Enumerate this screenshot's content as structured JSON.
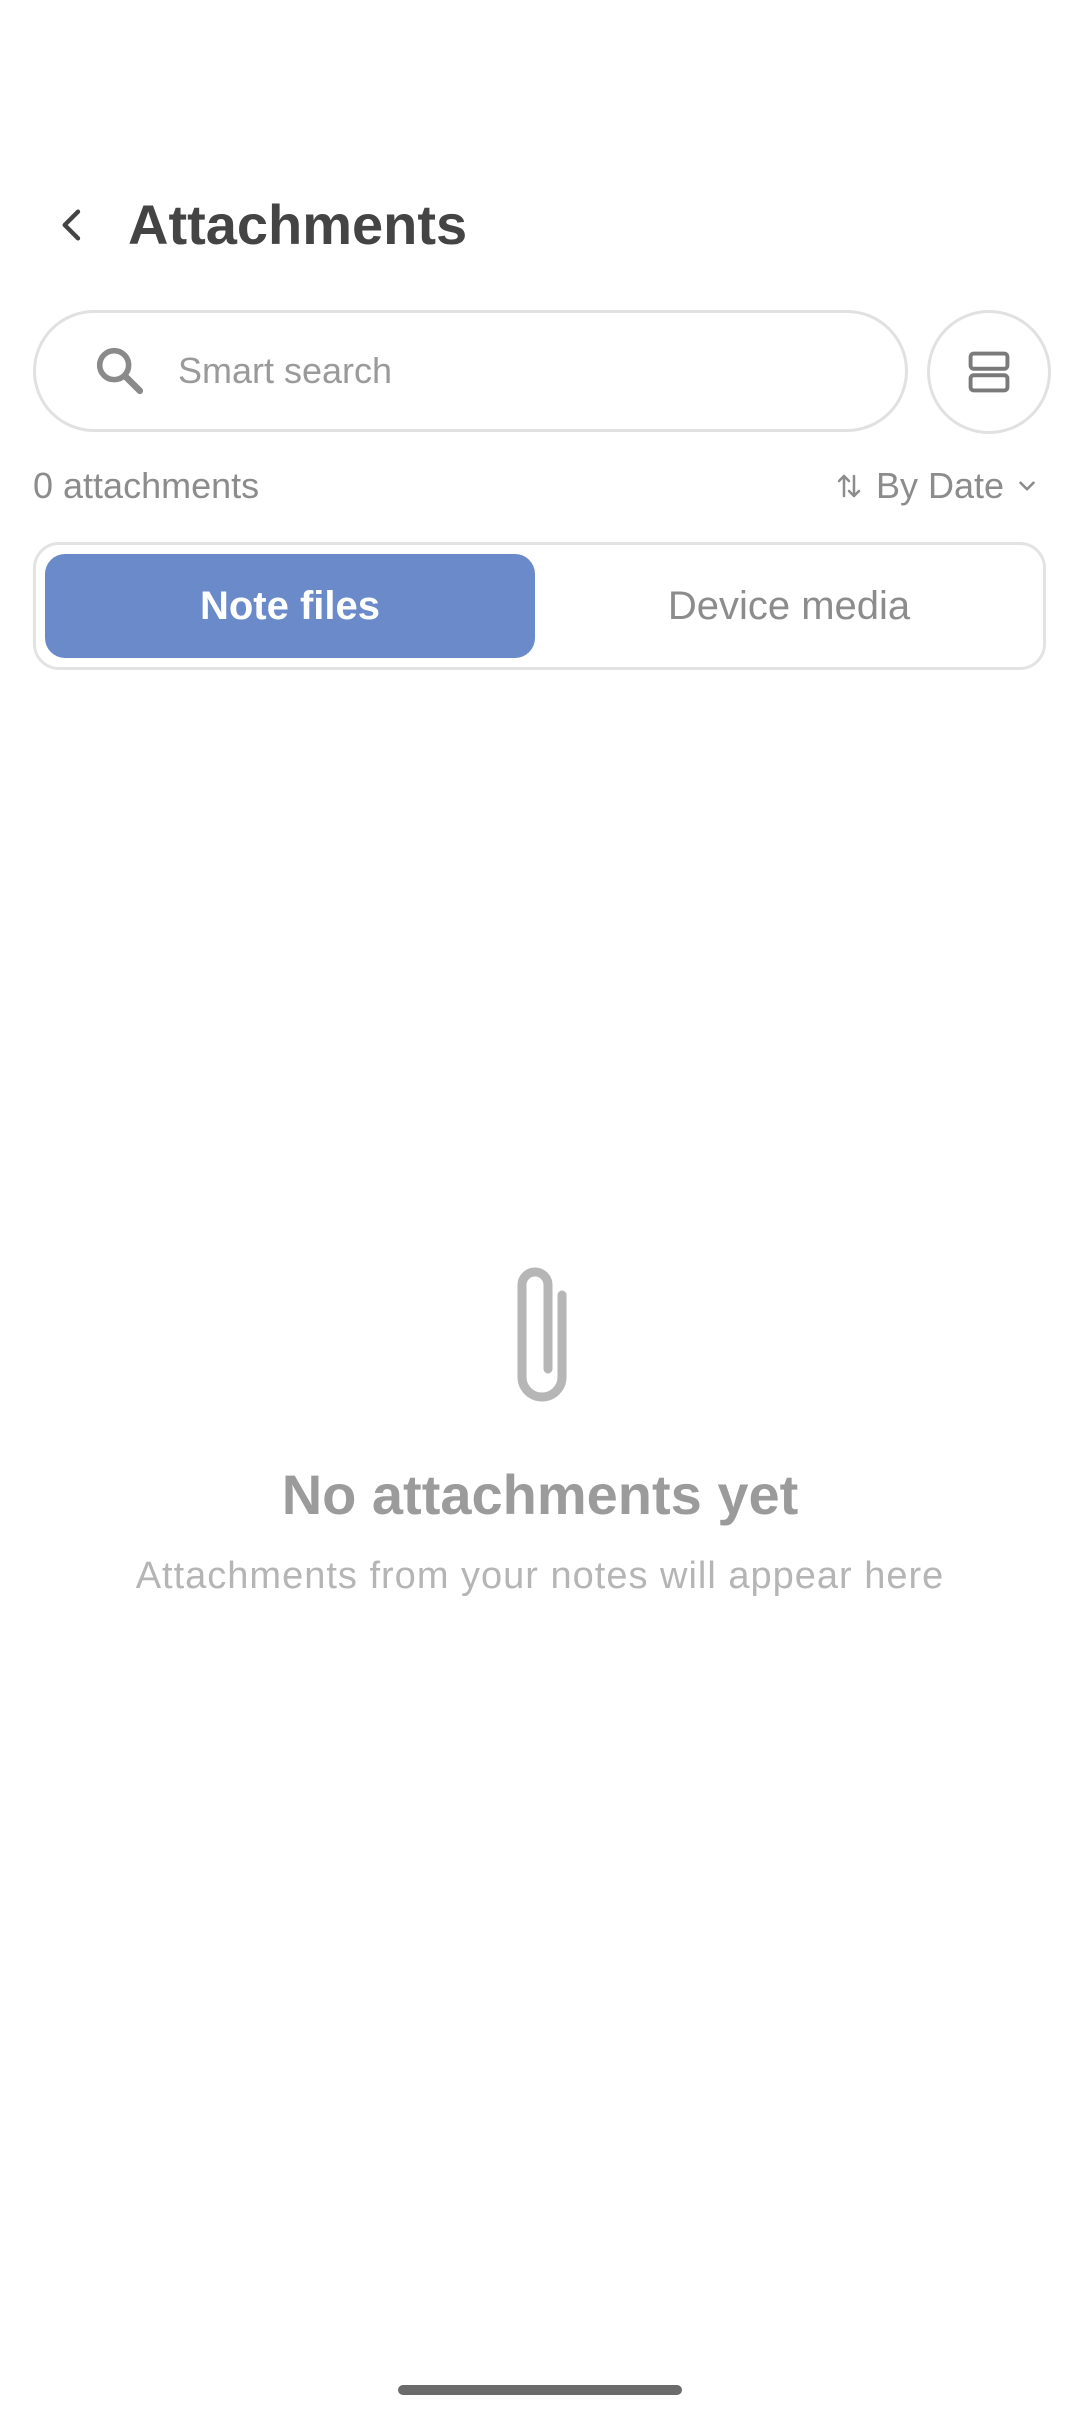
{
  "header": {
    "title": "Attachments",
    "back_icon": "chevron-left-icon"
  },
  "search": {
    "placeholder": "Smart search",
    "value": "",
    "icon": "search-icon"
  },
  "view_toggle": {
    "icon": "view-layout-icon"
  },
  "summary": {
    "count_label": "0 attachments",
    "sort_label": "By Date",
    "sort_icon": "sort-arrows-icon",
    "dropdown_icon": "chevron-down-icon"
  },
  "tabs": [
    {
      "label": "Note files",
      "selected": true
    },
    {
      "label": "Device media",
      "selected": false
    }
  ],
  "empty_state": {
    "icon": "paperclip-icon",
    "title": "No attachments yet",
    "subtitle": "Attachments from your notes will appear here"
  },
  "colors": {
    "accent": "#6a8ac9",
    "text_primary": "#444444",
    "text_muted": "#8c8c8c",
    "border": "#e1e1e1"
  }
}
